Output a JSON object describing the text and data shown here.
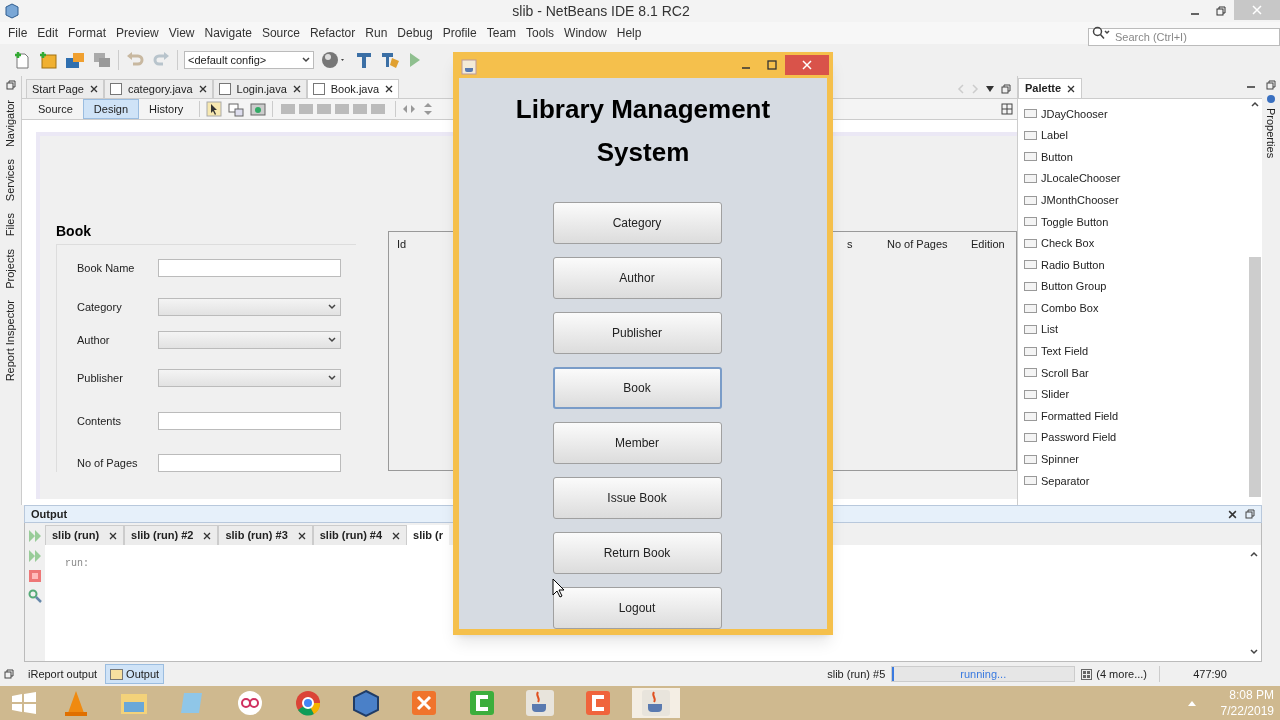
{
  "window": {
    "title": "slib - NetBeans IDE 8.1 RC2"
  },
  "menu": [
    "File",
    "Edit",
    "Format",
    "Preview",
    "View",
    "Navigate",
    "Source",
    "Refactor",
    "Run",
    "Debug",
    "Profile",
    "Team",
    "Tools",
    "Window",
    "Help"
  ],
  "search": {
    "placeholder": "Search (Ctrl+I)"
  },
  "toolbar": {
    "config": "<default config>"
  },
  "side_strip": [
    "Navigator",
    "Services",
    "Files",
    "Projects",
    "Report Inspector"
  ],
  "editor_tabs": [
    {
      "label": "Start Page",
      "selected": false
    },
    {
      "label": "category.java",
      "selected": false
    },
    {
      "label": "Login.java",
      "selected": false
    },
    {
      "label": "Book.java",
      "selected": true
    }
  ],
  "view_tabs": [
    {
      "label": "Source",
      "selected": false
    },
    {
      "label": "Design",
      "selected": true
    },
    {
      "label": "History",
      "selected": false
    }
  ],
  "form": {
    "title": "Book",
    "fields": [
      {
        "label": "Book Name",
        "kind": "text"
      },
      {
        "label": "Category",
        "kind": "combo"
      },
      {
        "label": "Author",
        "kind": "combo"
      },
      {
        "label": "Publisher",
        "kind": "combo"
      },
      {
        "label": "Contents",
        "kind": "text"
      },
      {
        "label": "No of Pages",
        "kind": "text"
      }
    ]
  },
  "table": {
    "columns": [
      "Id",
      "s",
      "No of Pages",
      "Edition"
    ]
  },
  "palette": {
    "title": "Palette",
    "items": [
      "JDayChooser",
      "Label",
      "Button",
      "JLocaleChooser",
      "JMonthChooser",
      "Toggle Button",
      "Check Box",
      "Radio Button",
      "Button Group",
      "Combo Box",
      "List",
      "Text Field",
      "Scroll Bar",
      "Slider",
      "Formatted Field",
      "Password Field",
      "Spinner",
      "Separator"
    ]
  },
  "properties_strip": "Properties",
  "output": {
    "title": "Output",
    "tabs": [
      {
        "label": "slib (run)",
        "selected": false
      },
      {
        "label": "slib (run) #2",
        "selected": false
      },
      {
        "label": "slib (run) #3",
        "selected": false
      },
      {
        "label": "slib (run) #4",
        "selected": false
      },
      {
        "label": "slib (r",
        "selected": true
      }
    ],
    "text": "run:"
  },
  "status_bar": {
    "tabs": [
      {
        "label": "iReport output",
        "selected": false
      },
      {
        "label": "Output",
        "selected": true
      }
    ],
    "task": "slib (run) #5",
    "progress": "running...",
    "level": 0.01,
    "more": "(4 more...)",
    "position": "477:90"
  },
  "dialog": {
    "heading": "Library Management System",
    "buttons": [
      {
        "label": "Category",
        "selected": false
      },
      {
        "label": "Author",
        "selected": false
      },
      {
        "label": "Publisher",
        "selected": false
      },
      {
        "label": "Book",
        "selected": true
      },
      {
        "label": "Member",
        "selected": false
      },
      {
        "label": "Issue Book",
        "selected": false
      },
      {
        "label": "Return Book",
        "selected": false
      },
      {
        "label": "Logout",
        "selected": false
      }
    ]
  },
  "taskbar": {
    "time": "8:08 PM",
    "date": "7/22/2019"
  }
}
